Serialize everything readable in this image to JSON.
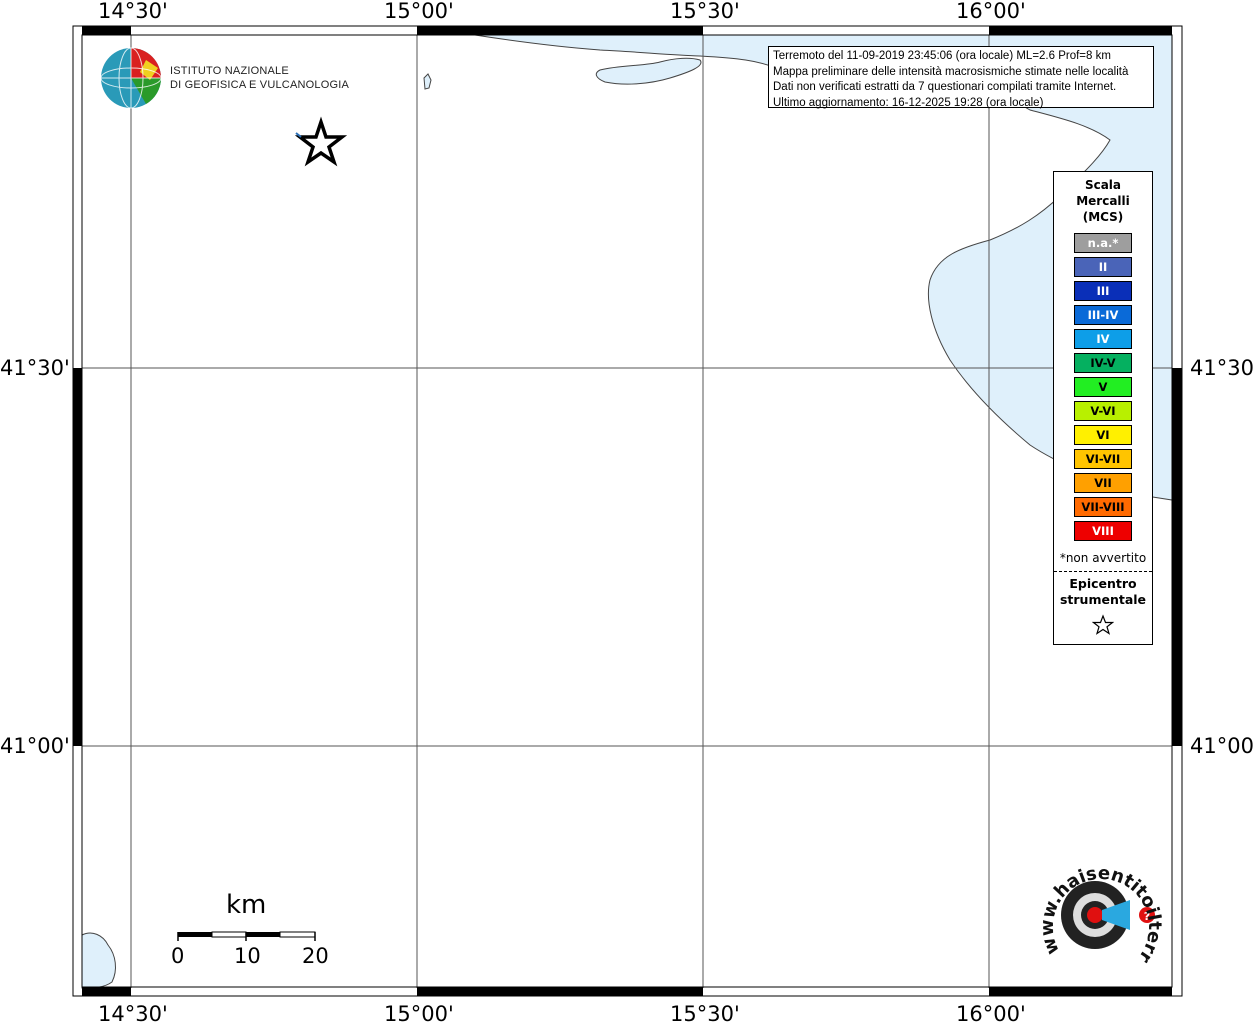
{
  "map": {
    "lon_labels": [
      "14°30'",
      "15°00'",
      "15°30'",
      "16°00'"
    ],
    "lat_labels": [
      "41°30'",
      "41°00'"
    ],
    "sea_color": "#dff0fb",
    "land_color": "#ffffff",
    "epicenter_marker": "star-icon"
  },
  "header_logo": {
    "line1": "ISTITUTO NAZIONALE",
    "line2": "DI GEOFISICA E VULCANOLOGIA"
  },
  "info": {
    "line1": "Terremoto del 11-09-2019 23:45:06 (ora locale) ML=2.6 Prof=8 km",
    "line2": "Mappa preliminare delle intensità macrosismiche stimate nelle località",
    "line3": "Dati non verificati estratti da 7 questionari compilati tramite Internet.",
    "line4": "Ultimo aggiornamento: 16-12-2025 19:28 (ora locale)"
  },
  "legend": {
    "title1": "Scala",
    "title2": "Mercalli",
    "title3": "(MCS)",
    "items": [
      {
        "label": "n.a.*",
        "color": "#9e9e9e"
      },
      {
        "label": "II",
        "color": "#4a64b8"
      },
      {
        "label": "III",
        "color": "#0a2fb8"
      },
      {
        "label": "III-IV",
        "color": "#0a6ad8"
      },
      {
        "label": "IV",
        "color": "#0d9ee8"
      },
      {
        "label": "IV-V",
        "color": "#05b060"
      },
      {
        "label": "V",
        "color": "#22ee22"
      },
      {
        "label": "V-VI",
        "color": "#b8f000"
      },
      {
        "label": "VI",
        "color": "#fff000"
      },
      {
        "label": "VI-VII",
        "color": "#ffc400"
      },
      {
        "label": "VII",
        "color": "#ffa000"
      },
      {
        "label": "VII-VIII",
        "color": "#ff6a00"
      },
      {
        "label": "VIII",
        "color": "#ee0000"
      }
    ],
    "note": "*non avvertito",
    "epicenter1": "Epicentro",
    "epicenter2": "strumentale"
  },
  "scale_bar": {
    "unit": "km",
    "ticks": [
      "0",
      "10",
      "20"
    ]
  },
  "footer_logo": {
    "text": "www.haisentitoilterremoto.it"
  }
}
